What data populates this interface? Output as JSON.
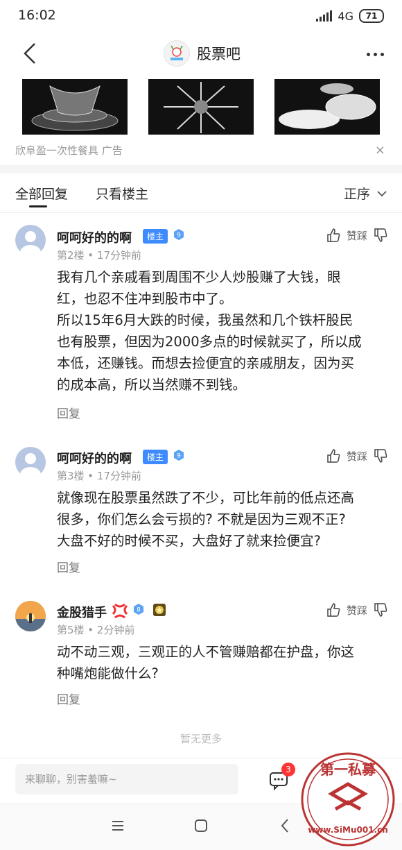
{
  "status": {
    "time": "16:02",
    "network": "4G",
    "battery": "71"
  },
  "header": {
    "title": "股票吧"
  },
  "ad": {
    "caption": "欣阜盈一次性餐具  广告",
    "close": "×"
  },
  "tabs": {
    "all": "全部回复",
    "owner_only": "只看楼主",
    "sort": "正序"
  },
  "posts": [
    {
      "name": "呵呵好的的啊",
      "badge": "楼主",
      "level": "9",
      "meta": "第2楼 • 17分钟前",
      "like": "赞踩",
      "lines": [
        "我有几个亲戚看到周围不少人炒股赚了大钱，眼",
        "红，也忍不住冲到股市中了。",
        "所以15年6月大跌的时候，我虽然和几个铁杆股民",
        "也有股票，但因为2000多点的时候就买了，所以成",
        "本低，还赚钱。而想去捡便宜的亲戚朋友，因为买",
        "的成本高，所以当然赚不到钱。"
      ],
      "reply": "回复"
    },
    {
      "name": "呵呵好的的啊",
      "badge": "楼主",
      "level": "9",
      "meta": "第3楼 • 17分钟前",
      "like": "赞踩",
      "lines": [
        "就像现在股票虽然跌了不少，可比年前的低点还高",
        "很多，你们怎么会亏损的? 不就是因为三观不正?",
        "大盘不好的时候不买，大盘好了就来捡便宜?"
      ],
      "reply": "回复"
    },
    {
      "name": "金股猎手",
      "level": "8",
      "meta": "第5楼 • 2分钟前",
      "like": "赞踩",
      "lines": [
        "动不动三观，三观正的人不管赚赔都在护盘，你这",
        "种嘴炮能做什么?"
      ],
      "reply": "回复"
    }
  ],
  "footer": {
    "no_more": "暂无更多",
    "input_placeholder": "来聊聊，别害羞嘛~",
    "chat_badge": "3"
  },
  "watermark": {
    "text": "第一私募",
    "url": "www.SiMu001.cn"
  },
  "colors": {
    "accent": "#3d8bff",
    "badge_red": "#ff3333"
  }
}
